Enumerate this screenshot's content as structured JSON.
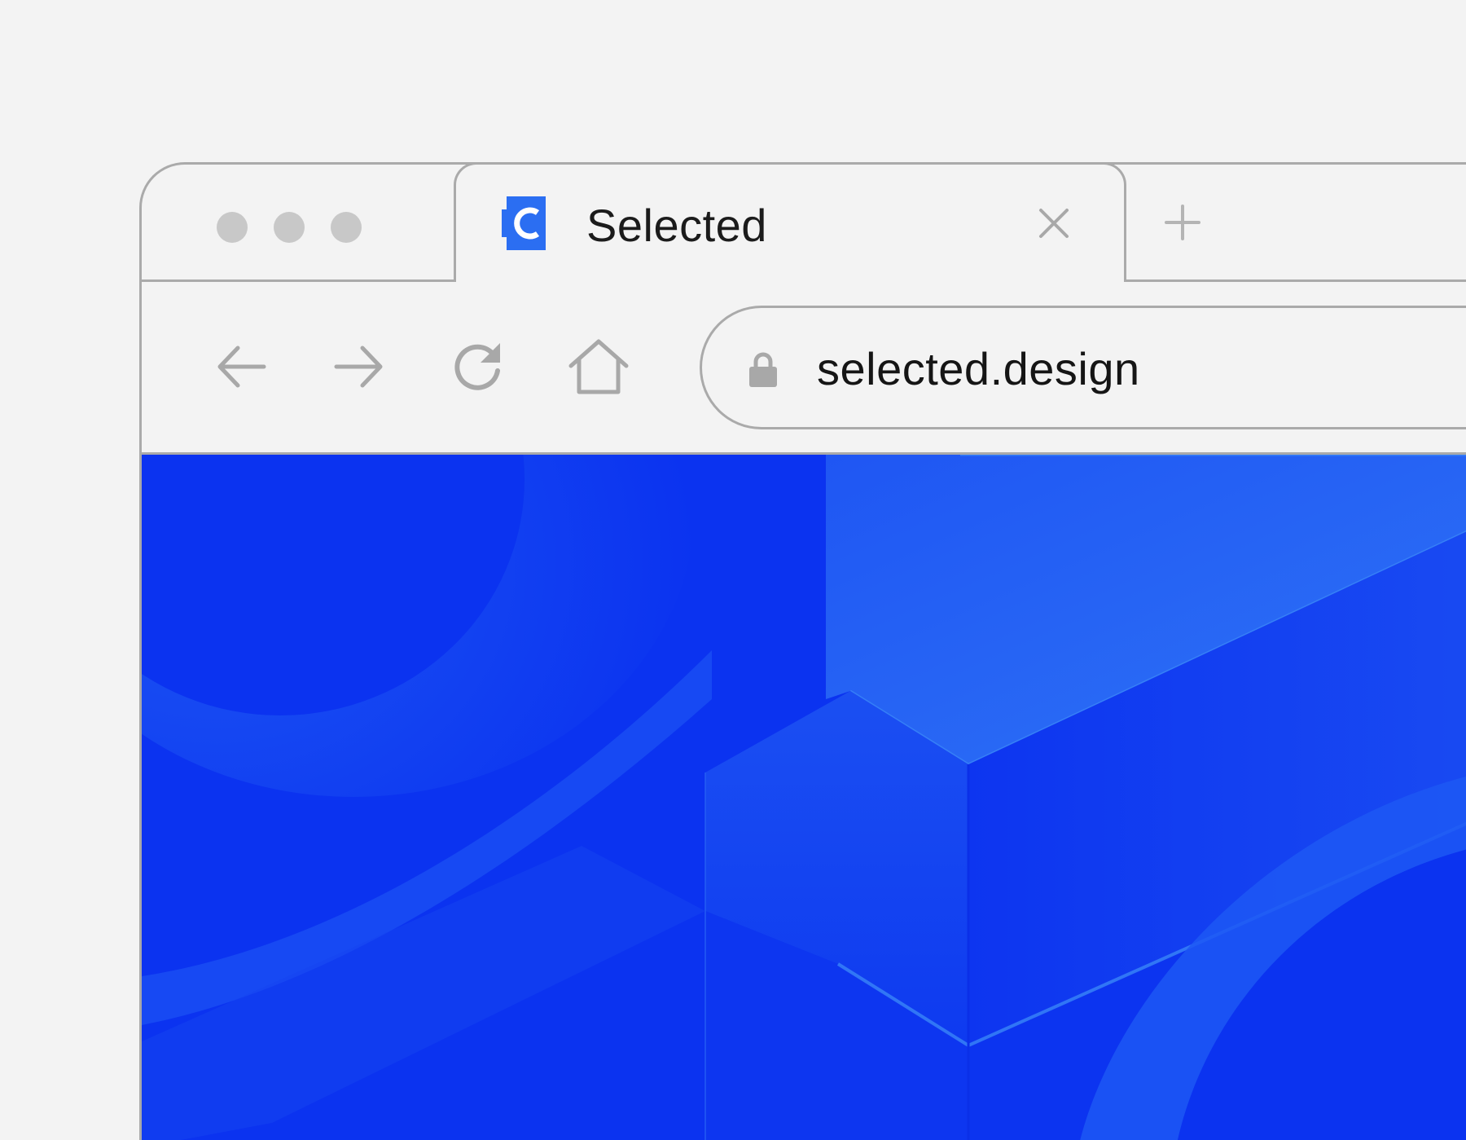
{
  "window": {
    "traffic_lights": [
      "window-control-dot",
      "window-control-dot",
      "window-control-dot"
    ]
  },
  "tab": {
    "title": "Selected",
    "favicon": "selected-logo-icon",
    "close_icon": "close-icon"
  },
  "new_tab_icon": "plus-icon",
  "toolbar": {
    "back_icon": "arrow-left-icon",
    "forward_icon": "arrow-right-icon",
    "reload_icon": "reload-icon",
    "home_icon": "home-icon"
  },
  "address_bar": {
    "lock_icon": "lock-icon",
    "url": "selected.design"
  },
  "colors": {
    "page_background": "#f3f3f3",
    "chrome_border": "#aaaaaa",
    "icon_gray": "#a8a8a8",
    "brand_blue": "#0b33f0",
    "brand_light_blue": "#2a72f5"
  }
}
